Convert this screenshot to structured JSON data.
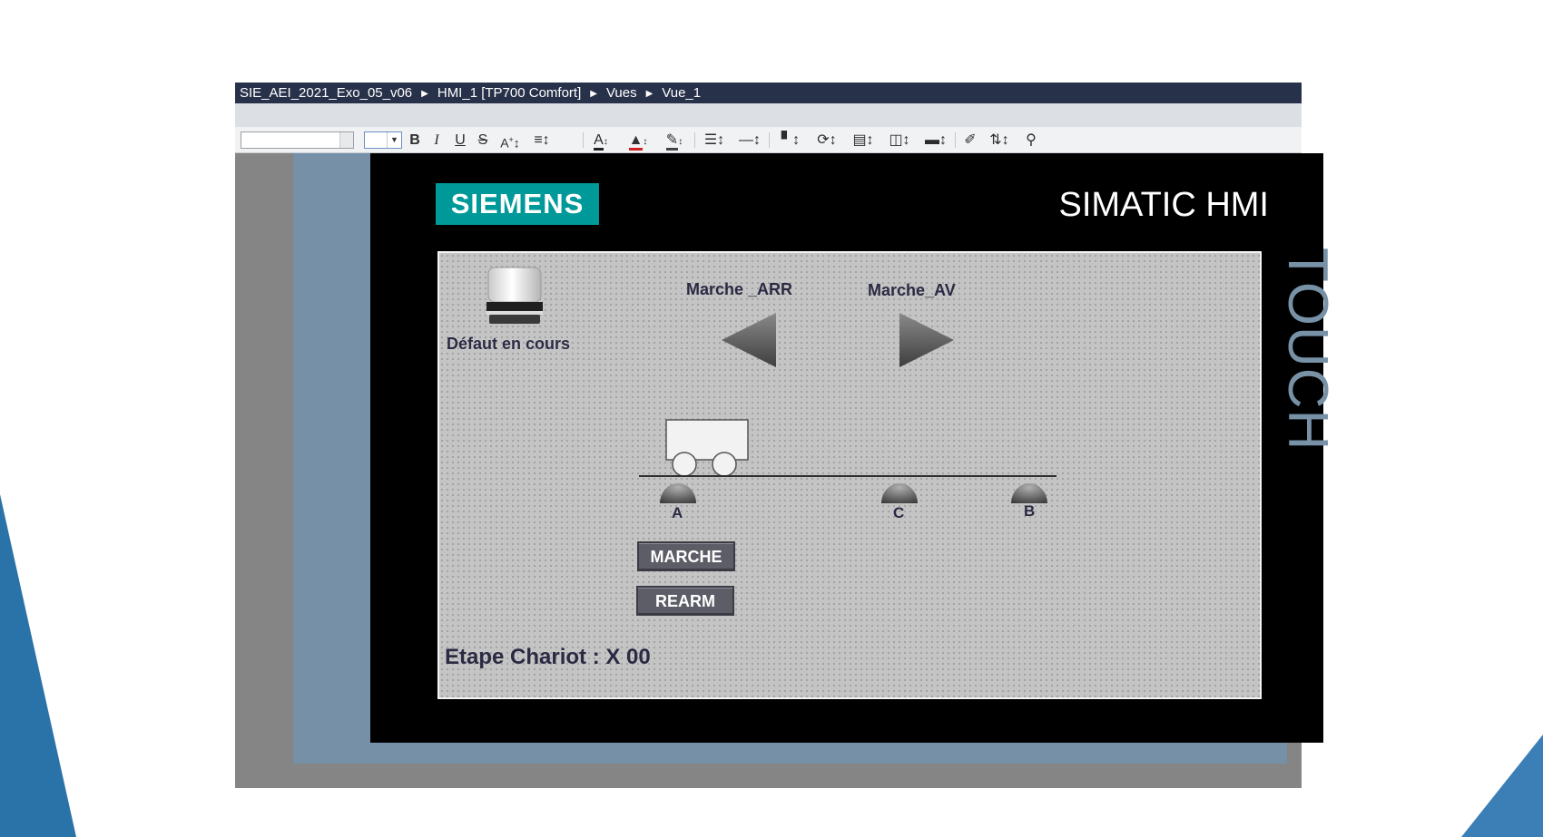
{
  "breadcrumb": {
    "items": [
      "SIE_AEI_2021_Exo_05_v06",
      "HMI_1 [TP700 Comfort]",
      "Vues",
      "Vue_1"
    ]
  },
  "toolbar": {
    "bold": "B",
    "italic": "I",
    "underline": "U",
    "strikethrough": "S",
    "icons": [
      "bold-icon",
      "italic-icon",
      "underline-icon",
      "strikethrough-icon",
      "font-size-icon",
      "text-align-icon",
      "font-color-icon",
      "fill-color-icon",
      "line-color-icon",
      "line-style-icon",
      "line-width-icon",
      "align-objects-icon",
      "rotate-icon",
      "distribute-icon",
      "spacing-icon",
      "layer-icon",
      "format-painter-icon",
      "sort-icon",
      "zoom-icon"
    ]
  },
  "device": {
    "brand": "SIEMENS",
    "model": "SIMATIC HMI",
    "touch_label": "TOUCH",
    "colors": {
      "brand": "#009999",
      "bezel": "#7590a7",
      "screen": "#000000"
    }
  },
  "hmi": {
    "alarm_label": "Défaut en cours",
    "reverse_label": "Marche _ARR",
    "forward_label": "Marche_AV",
    "sensors": {
      "a": "A",
      "c": "C",
      "b": "B"
    },
    "start_button": "MARCHE",
    "reset_button": "REARM",
    "step_label": "Etape Chariot : X 00"
  }
}
